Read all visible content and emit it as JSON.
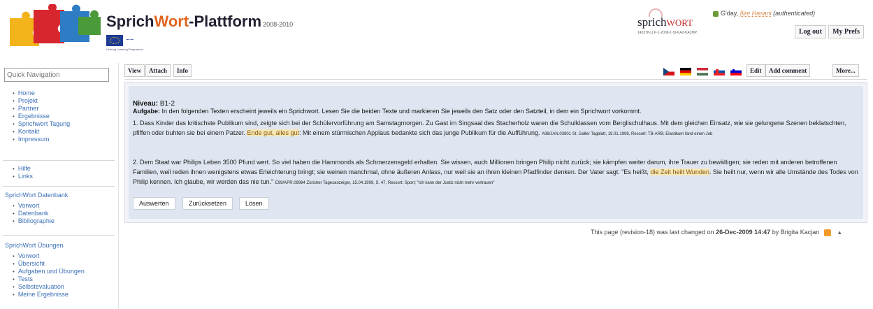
{
  "header": {
    "title_sprich": "Sprich",
    "title_wort": "Wort",
    "title_plattform": "-Plattform",
    "title_years": "2008-2010",
    "eu_text": "Lifelong Learning Programme",
    "sprich_logo_a": "sprich",
    "sprich_logo_b": "WORT",
    "sprich_logo_code": "143378-LLP-1-2008-1-SI-KA2-KA2MP",
    "greeting": "G'day,",
    "username": "Ilire Hasani",
    "auth": "(authenticated)",
    "logout_label": "Log out",
    "prefs_label": "My Prefs"
  },
  "sidebar": {
    "quicknav_placeholder": "Quick Navigation",
    "group1": [
      "Home",
      "Projekt",
      "Partner",
      "Ergebnisse",
      "Sprichwort Tagung",
      "Kontakt",
      "Impressum"
    ],
    "group2": [
      "Hilfe",
      "Links"
    ],
    "datenbank_heading": "SprichWort Datenbank",
    "datenbank_items": [
      "Vorwort",
      "Datenbank",
      "Bibliographie"
    ],
    "uebungen_heading": "SprichWort Übungen",
    "uebungen_items": [
      "Vorwort",
      "Übersicht",
      "Aufgaben und Übungen",
      "Tests",
      "Selbstevaluation",
      "Meine Ergebnisse"
    ]
  },
  "tabs": {
    "view": "View",
    "attach": "Attach",
    "info": "Info",
    "edit": "Edit",
    "add_comment": "Add comment",
    "more": "More..."
  },
  "exercise": {
    "niveau_label": "Niveau:",
    "niveau_value": "B1-2",
    "aufgabe_label": "Aufgabe:",
    "aufgabe_text": "In den folgenden Texten erscheint jeweils ein Sprichwort. Lesen Sie die beiden Texte und markieren Sie jeweils den Satz oder den Satzteil, in dem ein Sprichwort vorkommt.",
    "p1_before": "1. Dass Kinder das kritischste Publikum sind, zeigte sich bei der Schülervorführung am Samstagmorgen. Zu Gast im Singsaal des Stacherholz waren die Schulklassen vom Berglischulhaus. Mit dem gleichen Einsatz, wie sie gelungene Szenen beklatschten, pfiffen oder buhten sie bei einem Patzer.",
    "p1_highlight": "Ende gut, alles gut",
    "p1_after": ": Mit einem stürmischen Applaus bedankte sich das junge Publikum für die Aufführung.",
    "p1_source": "A98/JAN.03801 St. Galler Tagblatt, 19.01.1998, Ressort: TB-ARB; Elastikum fand einen Job",
    "p2_before": "2. Dem Staat war Philips Leben 3500 Pfund wert. So viel haben die Hammonds als Schmerzensgeld erhalten. Sie wissen, auch Millionen bringen Philip nicht zurück; sie kämpfen weiter darum, ihre Trauer zu bewältigen; sie reden mit anderen betroffenen Familien, weil reden ihnen wenigstens etwas Erleichterung bringt; sie weinen manchmal, ohne äußeren Anlass, nur weil sie an ihren kleinen Pfadfinder denken. Der Vater sagt: \"Es heißt,",
    "p2_highlight": "die Zeit heilt Wunden",
    "p2_after": ". Sie heilt nur, wenn wir alle Umstände des Todes von Philip kennen. Ich glaube, wir werden das nie tun.\"",
    "p2_source": "E99/APR.09984 Züricher Tagesanzeiger, 15.04.1999, S. 47, Ressort: Sport; \"Ich kann der Justiz nicht mehr vertrauen\"",
    "btn_auswerten": "Auswerten",
    "btn_zuruecksetzen": "Zurücksetzen",
    "btn_loesen": "Lösen"
  },
  "footer": {
    "text_a": "This page (revision-18) was last changed on",
    "date": "26-Dec-2009 14:47",
    "text_b": "by Brigita Kacjan"
  },
  "colors": {
    "accent": "#e0641e",
    "link": "#3b6fb6",
    "exercise_bg": "#dfe6f1",
    "highlight": "#f5e6b4"
  }
}
